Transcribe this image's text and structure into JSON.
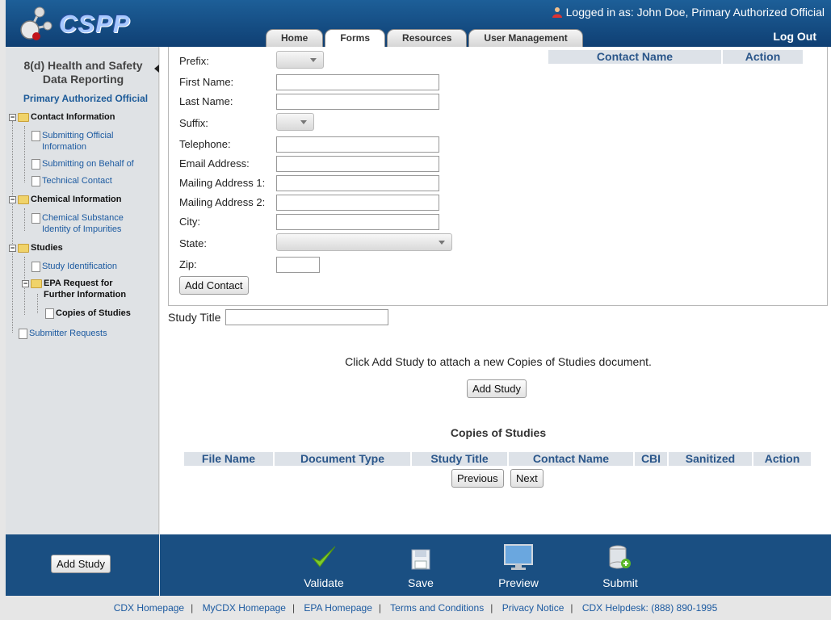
{
  "header": {
    "logo_text": "CSPP",
    "logged_in": "Logged in as: John Doe, Primary Authorized Official",
    "logout": "Log Out",
    "tabs": [
      {
        "label": "Home",
        "active": false
      },
      {
        "label": "Forms",
        "active": true
      },
      {
        "label": "Resources",
        "active": false
      },
      {
        "label": "User Management",
        "active": false
      }
    ]
  },
  "sidebar": {
    "title": "8(d) Health and Safety Data Reporting",
    "role": "Primary Authorized Official",
    "tree": {
      "contact_information": "Contact Information",
      "submitting_official": "Submitting Official Information",
      "submitting_behalf": "Submitting on Behalf of",
      "technical_contact": "Technical Contact",
      "chemical_information": "Chemical Information",
      "chemical_substance": "Chemical Substance Identity of Impurities",
      "studies": "Studies",
      "study_identification": "Study Identification",
      "epa_request": "EPA Request for Further Information",
      "copies_of_studies": "Copies of Studies",
      "submitter_requests": "Submitter Requests"
    }
  },
  "contact_form": {
    "prefix_label": "Prefix:",
    "first_name_label": "First Name:",
    "last_name_label": "Last Name:",
    "suffix_label": "Suffix:",
    "telephone_label": "Telephone:",
    "email_label": "Email Address:",
    "mailing1_label": "Mailing Address 1:",
    "mailing2_label": "Mailing Address 2:",
    "city_label": "City:",
    "state_label": "State:",
    "zip_label": "Zip:",
    "add_contact_button": "Add Contact",
    "table_headers": [
      "Contact Name",
      "Action"
    ]
  },
  "study": {
    "title_label": "Study Title",
    "info_text": "Click Add Study to attach a new Copies of Studies document.",
    "add_study_button": "Add Study",
    "copies_heading": "Copies of Studies",
    "table_headers": [
      "File Name",
      "Document Type",
      "Study Title",
      "Contact Name",
      "CBI",
      "Sanitized",
      "Action"
    ],
    "previous_button": "Previous",
    "next_button": "Next"
  },
  "bottom": {
    "add_study_button": "Add Study",
    "actions": [
      "Validate",
      "Save",
      "Preview",
      "Submit"
    ]
  },
  "footer": {
    "links": [
      "CDX Homepage",
      "MyCDX Homepage",
      "EPA Homepage",
      "Terms and Conditions",
      "Privacy Notice",
      "CDX Helpdesk: (888) 890-1995"
    ]
  },
  "colors": {
    "header_blue": "#1a4f82",
    "link_blue": "#1c5aa0",
    "table_header_bg": "#dde2e8"
  }
}
